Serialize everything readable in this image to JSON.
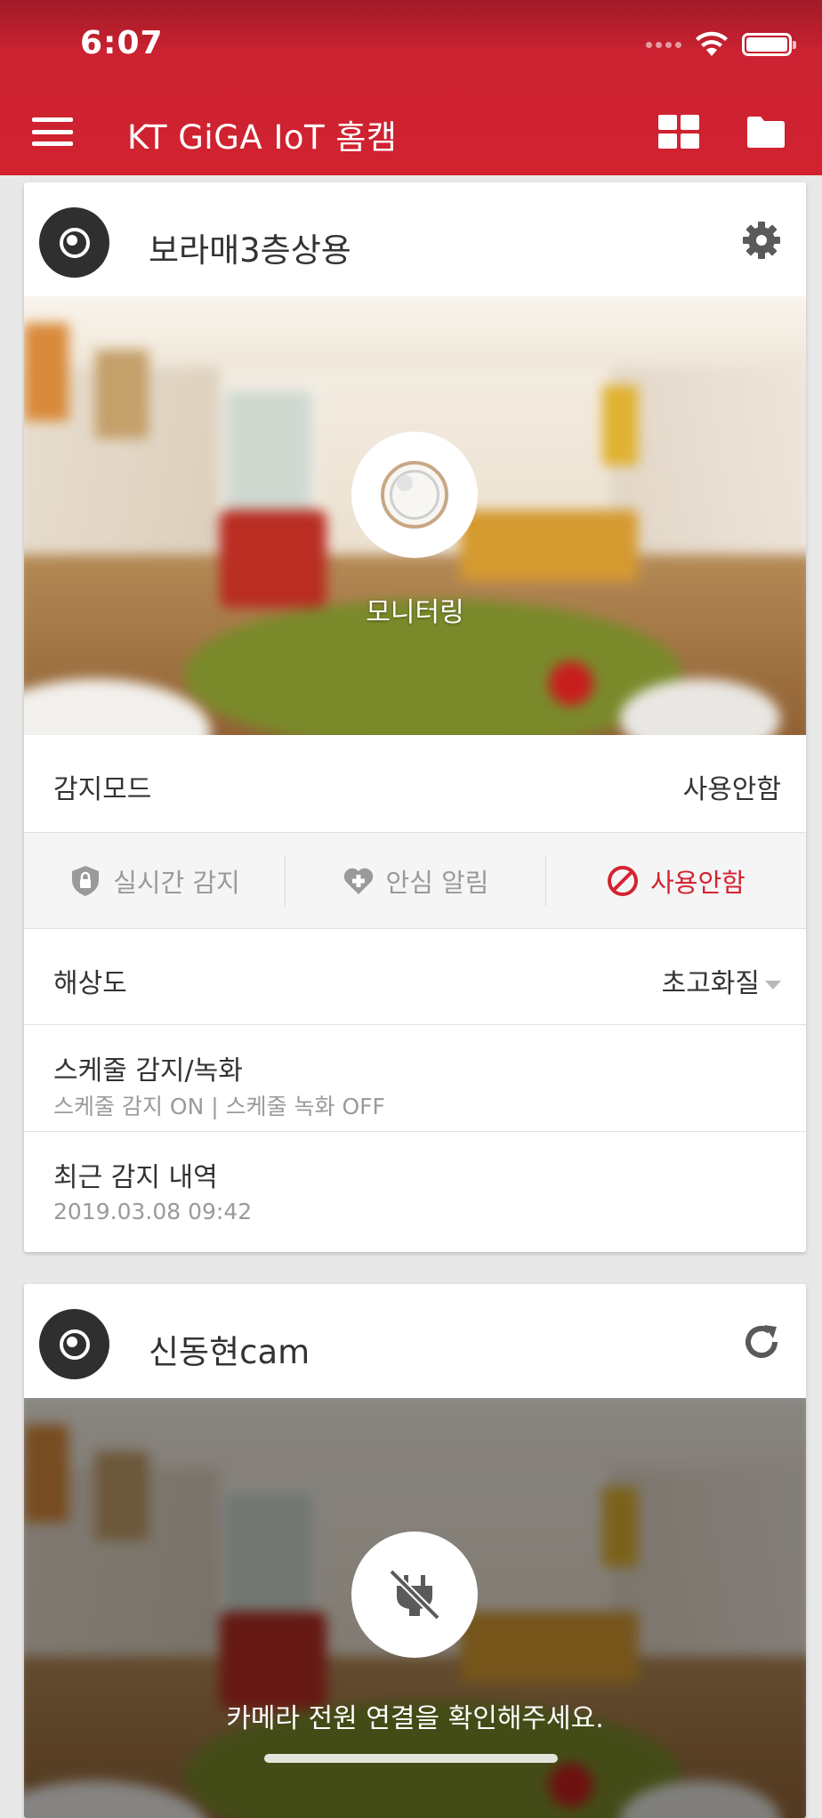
{
  "status_bar": {
    "time": "6:07"
  },
  "app_bar": {
    "title": "KT GiGA IoT 홈캠"
  },
  "cameras": [
    {
      "name": "보라매3층상용",
      "preview_caption": "모니터링",
      "detect_mode": {
        "label": "감지모드",
        "value": "사용안함"
      },
      "modes": [
        {
          "label": "실시간 감지",
          "icon": "shield-lock-icon",
          "active": false
        },
        {
          "label": "안심 알림",
          "icon": "heart-plus-icon",
          "active": false
        },
        {
          "label": "사용안함",
          "icon": "prohibited-icon",
          "active": true
        }
      ],
      "resolution": {
        "label": "해상도",
        "value": "초고화질"
      },
      "schedule": {
        "label": "스케줄 감지/녹화",
        "sub": "스케줄 감지 ON | 스케줄 녹화 OFF"
      },
      "recent": {
        "label": "최근 감지 내역",
        "sub": "2019.03.08 09:42"
      }
    },
    {
      "name": "신동현cam",
      "offline_message": "카메라 전원 연결을 확인해주세요."
    }
  ],
  "colors": {
    "brand_red": "#d1222f",
    "active_red": "#d42331"
  }
}
